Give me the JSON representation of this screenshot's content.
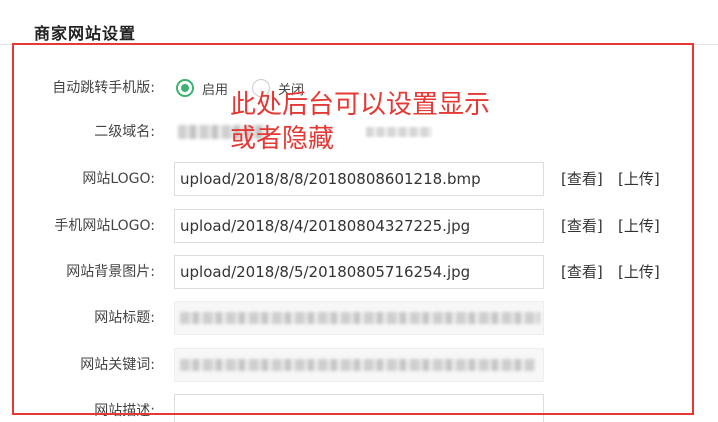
{
  "section": {
    "title": "商家网站设置"
  },
  "annotation": {
    "text": "此处后台可以设置显示\n或者隐藏",
    "color": "#e53935"
  },
  "highlight_color": "#e53935",
  "accent_color": "#3cb371",
  "form": {
    "mobile_redirect": {
      "label": "自动跳转手机版:",
      "options": [
        {
          "label": "启用",
          "checked": true
        },
        {
          "label": "关闭",
          "checked": false
        }
      ]
    },
    "subdomain": {
      "label": "二级域名:"
    },
    "logo": {
      "label": "网站LOGO:",
      "value": "upload/2018/8/8/20180808601218.bmp",
      "view_label": "[查看]",
      "upload_label": "[上传]"
    },
    "mobile_logo": {
      "label": "手机网站LOGO:",
      "value": "upload/2018/8/4/20180804327225.jpg",
      "view_label": "[查看]",
      "upload_label": "[上传]"
    },
    "background": {
      "label": "网站背景图片:",
      "value": "upload/2018/8/5/20180805716254.jpg",
      "view_label": "[查看]",
      "upload_label": "[上传]"
    },
    "site_title": {
      "label": "网站标题:"
    },
    "keywords": {
      "label": "网站关键词:"
    },
    "description": {
      "label": "网站描述:"
    }
  }
}
